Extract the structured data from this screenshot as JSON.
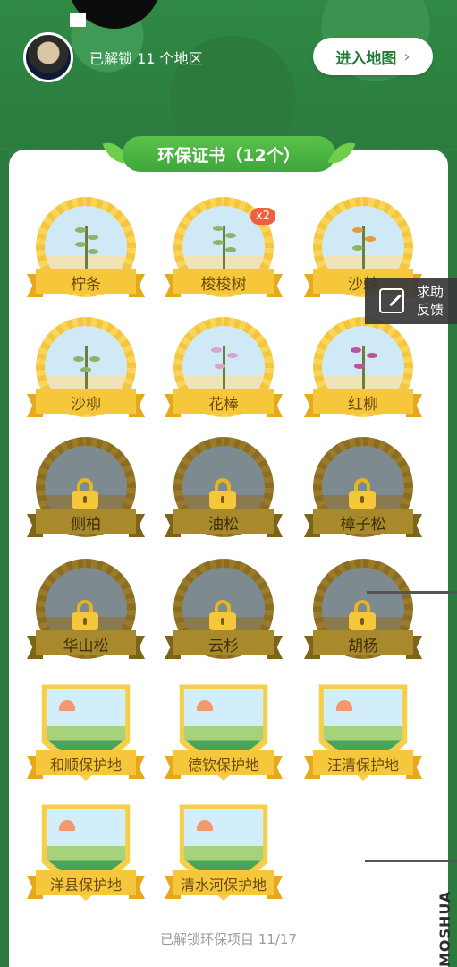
{
  "header": {
    "unlock_text": "已解锁 11 个地区",
    "map_button": "进入地图",
    "map_chevron": "›"
  },
  "section": {
    "title": "环保证书（12个）"
  },
  "badges": [
    {
      "label": "柠条",
      "locked": false
    },
    {
      "label": "梭梭树",
      "locked": false,
      "count": "x2"
    },
    {
      "label": "沙棘",
      "locked": false
    },
    {
      "label": "沙柳",
      "locked": false
    },
    {
      "label": "花棒",
      "locked": false
    },
    {
      "label": "红柳",
      "locked": false
    },
    {
      "label": "侧柏",
      "locked": true
    },
    {
      "label": "油松",
      "locked": true
    },
    {
      "label": "樟子松",
      "locked": true
    },
    {
      "label": "华山松",
      "locked": true
    },
    {
      "label": "云杉",
      "locked": true
    },
    {
      "label": "胡杨",
      "locked": true
    }
  ],
  "reserves": [
    {
      "label": "和顺保护地"
    },
    {
      "label": "德钦保护地"
    },
    {
      "label": "汪清保护地"
    },
    {
      "label": "洋县保护地"
    },
    {
      "label": "清水河保护地"
    }
  ],
  "feedback": {
    "line1": "求助",
    "line2": "反馈"
  },
  "footer": {
    "text": "已解锁环保项目 11/17"
  },
  "watermark": "MOSHUA",
  "colors": {
    "brand_green": "#3fa63c",
    "gold": "#f6c73a",
    "locked_gold": "#a88a2c",
    "count_red": "#f0603f"
  }
}
